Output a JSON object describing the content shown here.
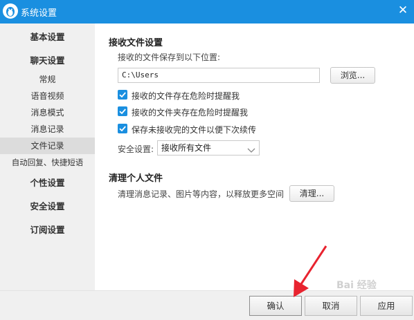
{
  "window": {
    "title": "系统设置",
    "close_glyph": "✕",
    "accent_color": "#1a8fe0"
  },
  "sidebar": {
    "items": [
      {
        "label": "基本设置",
        "kind": "major"
      },
      {
        "label": "聊天设置",
        "kind": "major"
      },
      {
        "label": "常规",
        "kind": "minor"
      },
      {
        "label": "语音视频",
        "kind": "minor"
      },
      {
        "label": "消息模式",
        "kind": "minor"
      },
      {
        "label": "消息记录",
        "kind": "minor"
      },
      {
        "label": "文件记录",
        "kind": "minor",
        "active": true
      },
      {
        "label": "自动回复、快捷短语",
        "kind": "minor"
      },
      {
        "label": "个性设置",
        "kind": "major"
      },
      {
        "label": "安全设置",
        "kind": "major"
      },
      {
        "label": "订阅设置",
        "kind": "major"
      }
    ]
  },
  "receive": {
    "title": "接收文件设置",
    "save_label": "接收的文件保存到以下位置:",
    "path_value": "C:\\Users",
    "browse_label": "浏览...",
    "checkboxes": [
      {
        "label": "接收的文件存在危险时提醒我",
        "checked": true
      },
      {
        "label": "接收的文件夹存在危险时提醒我",
        "checked": true
      },
      {
        "label": "保存未接收完的文件以便下次续传",
        "checked": true
      }
    ],
    "security_label": "安全设置:",
    "security_value": "接收所有文件"
  },
  "cleanup": {
    "title": "清理个人文件",
    "description": "清理消息记录、图片等内容，以释放更多空间",
    "clean_label": "清理..."
  },
  "footer": {
    "confirm_label": "确认",
    "cancel_label": "取消",
    "apply_label": "应用"
  },
  "annotation": {
    "arrow_color": "#e8232f"
  },
  "watermark": {
    "text": "Bai 经验"
  }
}
